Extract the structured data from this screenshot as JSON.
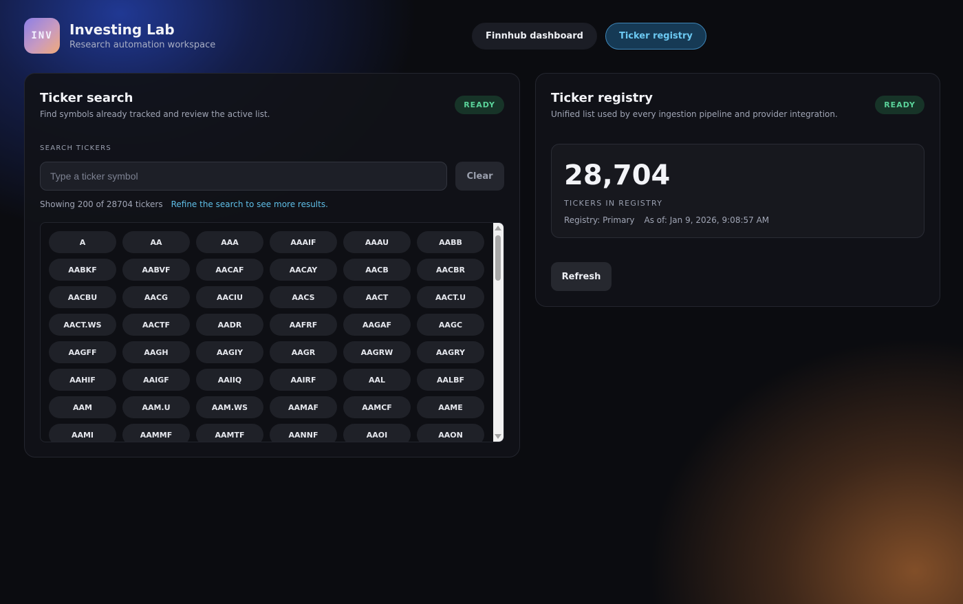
{
  "brand": {
    "logo_text": "INV",
    "title": "Investing Lab",
    "subtitle": "Research automation workspace"
  },
  "nav": {
    "items": [
      {
        "label": "Finnhub dashboard",
        "active": false
      },
      {
        "label": "Ticker registry",
        "active": true
      }
    ]
  },
  "search_panel": {
    "title": "Ticker search",
    "description": "Find symbols already tracked and review the active list.",
    "badge": "READY",
    "field_label": "SEARCH TICKERS",
    "input_value": "",
    "input_placeholder": "Type a ticker symbol",
    "clear_label": "Clear",
    "showing_text": "Showing 200 of 28704 tickers",
    "refine_text": "Refine the search to see more results.",
    "tickers": [
      "A",
      "AA",
      "AAA",
      "AAAIF",
      "AAAU",
      "AABB",
      "AABKF",
      "AABVF",
      "AACAF",
      "AACAY",
      "AACB",
      "AACBR",
      "AACBU",
      "AACG",
      "AACIU",
      "AACS",
      "AACT",
      "AACT.U",
      "AACT.WS",
      "AACTF",
      "AADR",
      "AAFRF",
      "AAGAF",
      "AAGC",
      "AAGFF",
      "AAGH",
      "AAGIY",
      "AAGR",
      "AAGRW",
      "AAGRY",
      "AAHIF",
      "AAIGF",
      "AAIIQ",
      "AAIRF",
      "AAL",
      "AALBF",
      "AAM",
      "AAM.U",
      "AAM.WS",
      "AAMAF",
      "AAMCF",
      "AAME",
      "AAMI",
      "AAMMF",
      "AAMTF",
      "AANNF",
      "AAOI",
      "AAON"
    ]
  },
  "registry_panel": {
    "title": "Ticker registry",
    "description": "Unified list used by every ingestion pipeline and provider integration.",
    "badge": "READY",
    "count": "28,704",
    "count_label": "TICKERS IN REGISTRY",
    "registry": "Registry: Primary",
    "as_of": "As of: Jan 9, 2026, 9:08:57 AM",
    "refresh_label": "Refresh"
  },
  "colors": {
    "accent": "#6cc9f2",
    "ready_badge": "#5ad39a",
    "background": "#0b0c10"
  }
}
